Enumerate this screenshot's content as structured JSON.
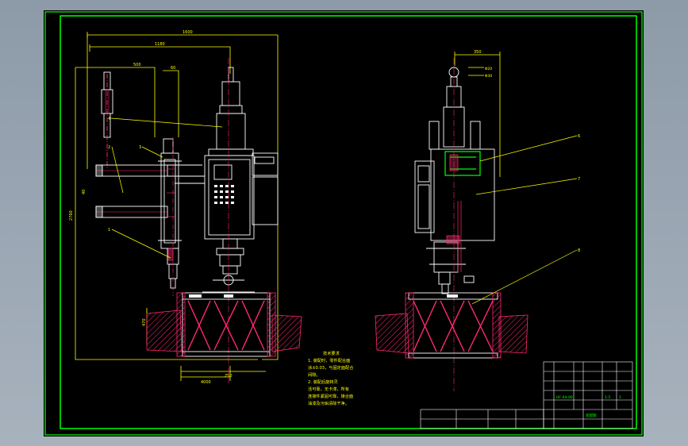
{
  "drawing": {
    "left_view": {
      "dim_top": "1600",
      "dim_2": "1180",
      "dim_3": "500",
      "dim_4": "60",
      "dim_vertical": "2760",
      "dim_small": "40",
      "dim_depth": "470",
      "dim_bottom_1": "250",
      "dim_bottom_2": "4000",
      "callout_1": "1",
      "callout_2": "2",
      "callout_3": "3",
      "callout_4": "4"
    },
    "right_view": {
      "dim_top": "350",
      "dim_dia_1": "Φ20",
      "dim_dia_2": "Φ30",
      "callout_6": "6",
      "callout_7": "7",
      "callout_8": "8"
    },
    "notes": {
      "title": "技术要求",
      "line1": "1. 装配时，零件配合面",
      "line2": "涂±0.03，与固定面配合",
      "line3": "间隙。",
      "line4": "2. 装配后旋转灵",
      "line5": "活可靠，无卡滞，所有",
      "line6": "连接件紧固可靠，接合面",
      "line7": "油漆及污垢清除干净。"
    },
    "title_block": {
      "drawing_no": "HF-04-00",
      "scale": "1:5",
      "mass": "1",
      "material": "装配图"
    }
  },
  "colors": {
    "sheet_border": "#00ff00",
    "outline": "#ffffff",
    "dimension": "#ffff00",
    "hatch": "#ff2a6d",
    "center": "#ff2a6d",
    "leader": "#ffff00",
    "panel_green": "#00ff00"
  }
}
